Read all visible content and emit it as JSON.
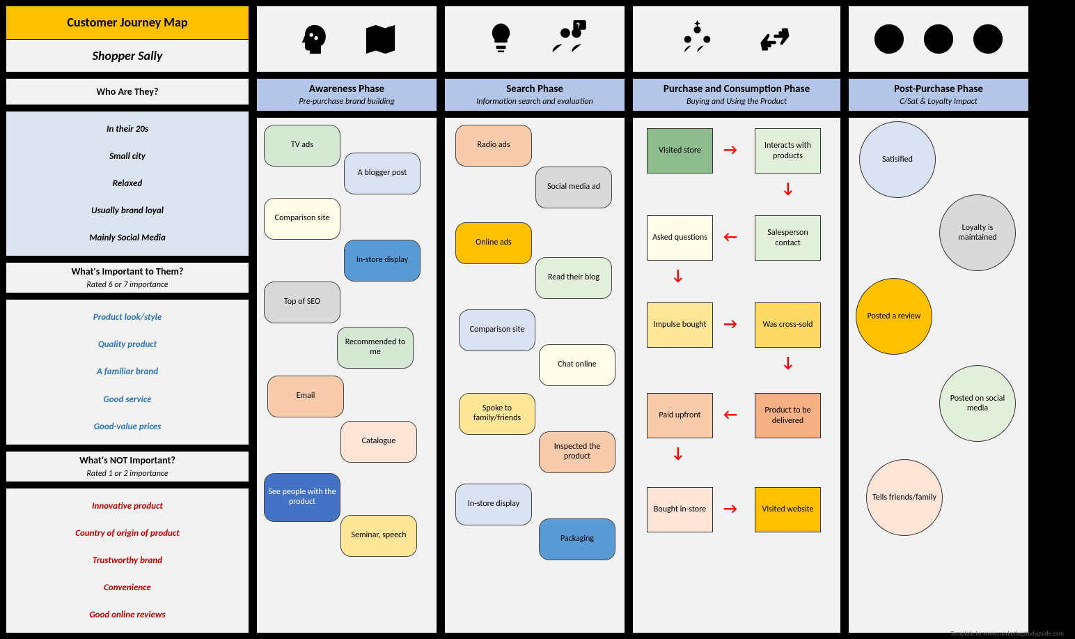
{
  "title": "Customer Journey Map",
  "persona_name": "Shopper Sally",
  "credit": "Template by www.marketingstudyguide.com",
  "sidebar": {
    "who_q": "Who Are They?",
    "who": [
      "In their 20s",
      "Small city",
      "Relaxed",
      "Usually brand loyal",
      "Mainly Social Media"
    ],
    "important_q": "What's Important to Them?",
    "important_rating": "Rated 6 or 7 importance",
    "important": [
      "Product look/style",
      "Quality product",
      "A familiar brand",
      "Good service",
      "Good-value prices"
    ],
    "not_q": "What's NOT Important?",
    "not_rating": "Rated 1 or 2 importance",
    "not": [
      "Innovative product",
      "Country of origin of product",
      "Trustworthy brand",
      "Convenience",
      "Good online reviews"
    ]
  },
  "phases": {
    "awareness": {
      "title": "Awareness Phase",
      "subtitle": "Pre-purchase brand building"
    },
    "search": {
      "title": "Search Phase",
      "subtitle": "Information search and evaluation"
    },
    "purchase": {
      "title": "Purchase and Consumption Phase",
      "subtitle": "Buying and Using the Product"
    },
    "post": {
      "title": "Post-Purchase Phase",
      "subtitle": "C/Sat & Loyalty Impact"
    }
  },
  "awareness": {
    "b1": "TV ads",
    "b2": "A blogger post",
    "b3": "Comparison site",
    "b4": "In-store display",
    "b5": "Top of SEO",
    "b6": "Recommended to me",
    "b7": "Email",
    "b8": "Catalogue",
    "b9": "See people with the product",
    "b10": "Seminar, speech"
  },
  "search": {
    "b1": "Radio ads",
    "b2": "Social media ad",
    "b3": "Online ads",
    "b4": "Read their blog",
    "b5": "Comparison site",
    "b6": "Chat online",
    "b7": "Spoke to family/friends",
    "b8": "Inspected the product",
    "b9": "In-store display",
    "b10": "Packaging"
  },
  "purchase": {
    "b1": "Visited store",
    "b2": "Interacts with products",
    "b3": "Asked questions",
    "b4": "Salesperson contact",
    "b5": "Impulse bought",
    "b6": "Was cross-sold",
    "b7": "Paid upfront",
    "b8": "Product to be delivered",
    "b9": "Bought in-store",
    "b10": "Visited website"
  },
  "post": {
    "c1": "Satisified",
    "c2": "Loyalty is maintained",
    "c3": "Posted a review",
    "c4": "Posted on social media",
    "c5": "Tells friends/family"
  }
}
